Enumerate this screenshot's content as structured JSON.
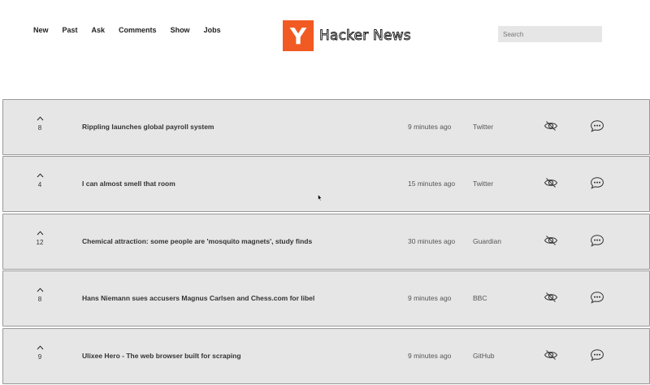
{
  "nav": {
    "items": [
      {
        "label": "New"
      },
      {
        "label": "Past"
      },
      {
        "label": "Ask"
      },
      {
        "label": "Comments"
      },
      {
        "label": "Show"
      },
      {
        "label": "Jobs"
      }
    ]
  },
  "logo": {
    "letter": "Y",
    "text": "Hacker News",
    "color": "#f15a22"
  },
  "search": {
    "placeholder": "Search",
    "value": ""
  },
  "icons": {
    "upvote": "upvote-arrow-icon",
    "hide": "eye-slash-icon",
    "comments": "speech-bubble-icon"
  },
  "stories": [
    {
      "votes": "8",
      "title": "Rippling launches global payroll system",
      "time": "9 minutes ago",
      "source": "Twitter"
    },
    {
      "votes": "4",
      "title": "I can almost smell that room",
      "time": "15 minutes ago",
      "source": "Twitter"
    },
    {
      "votes": "12",
      "title": "Chemical attraction: some people are 'mosquito magnets', study finds",
      "time": "30 minutes ago",
      "source": "Guardian"
    },
    {
      "votes": "8",
      "title": "Hans Niemann sues accusers Magnus Carlsen and Chess.com for libel",
      "time": "9 minutes ago",
      "source": "BBC"
    },
    {
      "votes": "9",
      "title": "Ulixee Hero - The web browser built for scraping",
      "time": "9 minutes ago",
      "source": "GitHub"
    }
  ]
}
